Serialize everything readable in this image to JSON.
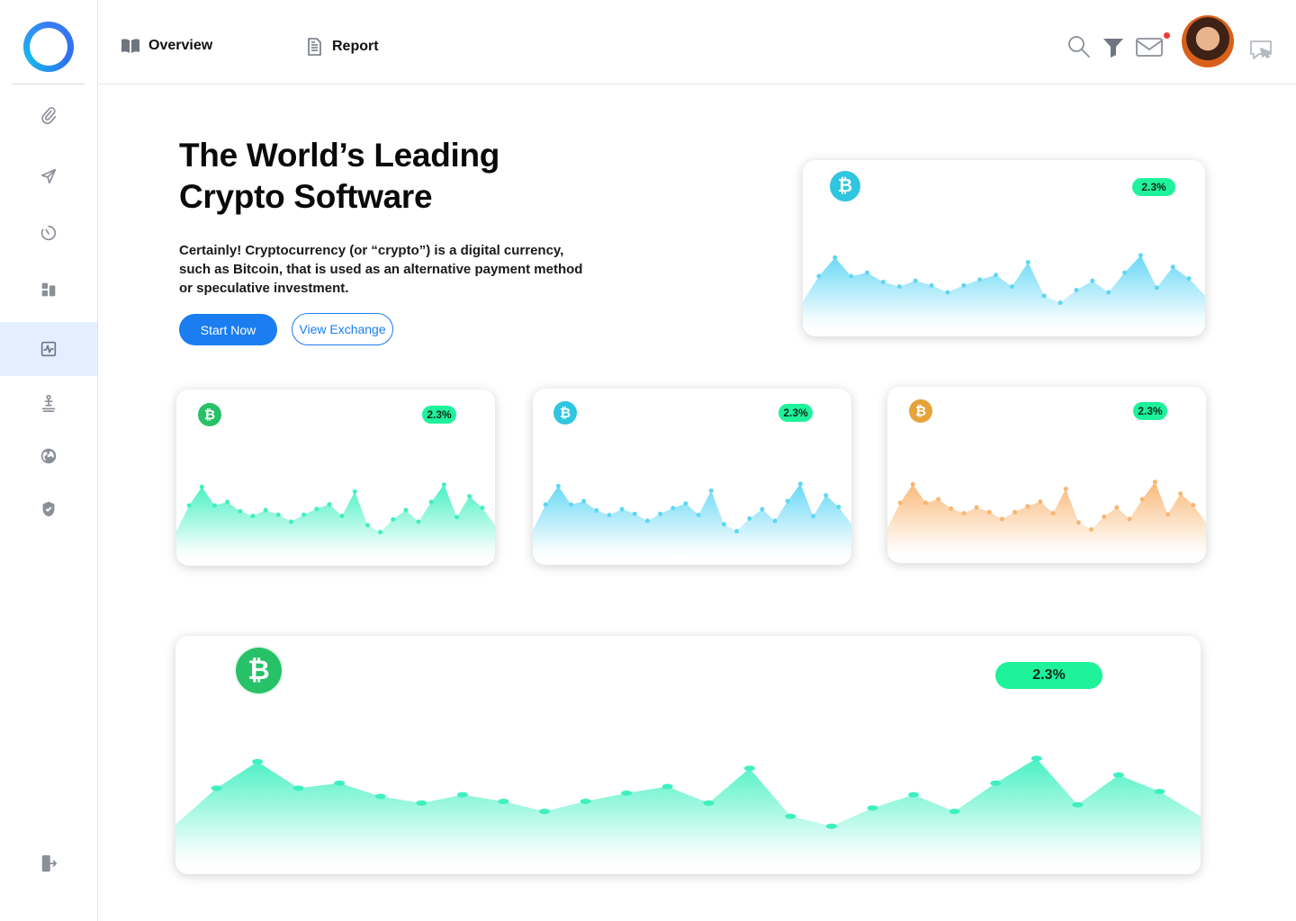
{
  "nav": {
    "overview_label": "Overview",
    "report_label": "Report"
  },
  "header_icons": [
    "search-icon",
    "filter-icon",
    "mail-icon",
    "avatar",
    "chat-icon"
  ],
  "sidebar": {
    "items": [
      {
        "icon": "paperclip-icon"
      },
      {
        "icon": "send-icon"
      },
      {
        "icon": "timer-icon"
      },
      {
        "icon": "dashboard-icon"
      },
      {
        "icon": "activity-icon",
        "active": true
      },
      {
        "icon": "user-podium-icon"
      },
      {
        "icon": "globe-icon"
      },
      {
        "icon": "shield-check-icon"
      }
    ],
    "logout_icon": "logout-icon"
  },
  "hero": {
    "title_line1": "The World’s Leading",
    "title_line2": "Crypto Software",
    "description": "Certainly! Cryptocurrency (or “crypto”) is a digital currency, such as Bitcoin, that is used as an alternative payment method or speculative investment.",
    "start_label": "Start Now",
    "exchange_label": "View Exchange"
  },
  "colors": {
    "accent": "#1a7df0",
    "badge": "#1ef29a",
    "cyan": "#5fd6f5",
    "teal": "#3ef0c0",
    "orange": "#f9b571",
    "green_coin": "#27c267",
    "cyan_coin": "#30c6e0",
    "orange_coin": "#e5a33a"
  },
  "cards": [
    {
      "id": "top",
      "coin_symbol": "₿",
      "change": "2.3%",
      "theme": "cyan"
    },
    {
      "id": "small-1",
      "coin_symbol": "₿",
      "change": "2.3%",
      "theme": "teal"
    },
    {
      "id": "small-2",
      "coin_symbol": "₿",
      "change": "2.3%",
      "theme": "cyan"
    },
    {
      "id": "small-3",
      "coin_symbol": "₿",
      "change": "2.3%",
      "theme": "orange"
    },
    {
      "id": "large",
      "coin_symbol": "₿",
      "change": "2.3%",
      "theme": "teal"
    }
  ],
  "chart_data": {
    "type": "area",
    "series": [
      {
        "values": [
          0.3,
          0.52,
          0.68,
          0.52,
          0.55,
          0.47,
          0.43,
          0.48,
          0.44,
          0.38,
          0.44,
          0.49,
          0.53,
          0.43,
          0.64,
          0.35,
          0.29,
          0.4,
          0.48,
          0.38,
          0.55,
          0.7,
          0.42,
          0.6,
          0.5,
          0.35
        ]
      }
    ]
  }
}
